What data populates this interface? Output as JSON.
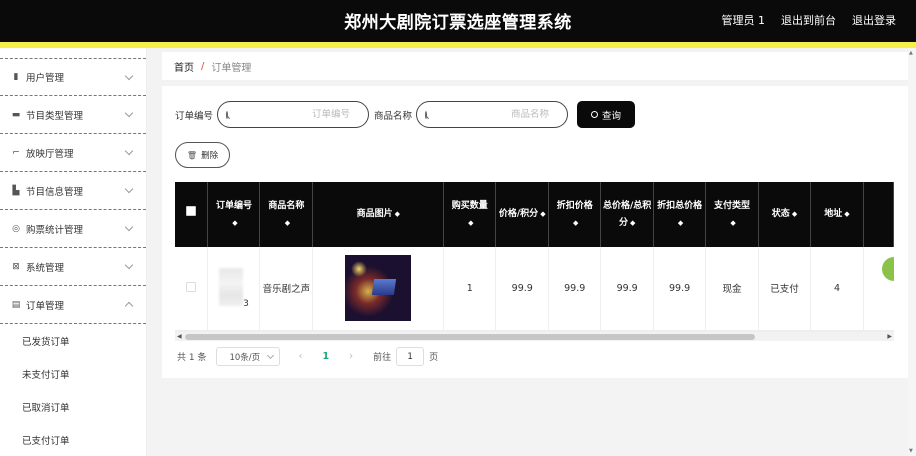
{
  "header": {
    "title": "郑州大剧院订票选座管理系统",
    "admin": "管理员 1",
    "to_front": "退出到前台",
    "logout": "退出登录"
  },
  "colors": {
    "accent_bar": "#f6ef4a",
    "header_bg": "#0a0a0a",
    "active_page": "#19a974",
    "status_dot": "#8bc34a"
  },
  "sidebar": {
    "items": [
      {
        "label": "用户管理",
        "icon": "bar-chart-icon"
      },
      {
        "label": "节目类型管理",
        "icon": "chat-icon"
      },
      {
        "label": "放映厅管理",
        "icon": "crop-icon"
      },
      {
        "label": "节目信息管理",
        "icon": "thumb-up-icon"
      },
      {
        "label": "购票统计管理",
        "icon": "disc-icon"
      },
      {
        "label": "系统管理",
        "icon": "grid-icon"
      },
      {
        "label": "订单管理",
        "icon": "document-icon"
      }
    ],
    "sub_items": [
      "已发货订单",
      "未支付订单",
      "已取消订单",
      "已支付订单"
    ]
  },
  "breadcrumb": {
    "home": "首页",
    "sep": "/",
    "current": "订单管理"
  },
  "search": {
    "order_label": "订单编号",
    "order_placeholder": "订单编号",
    "goods_label": "商品名称",
    "goods_placeholder": "商品名称",
    "query_label": "查询"
  },
  "actions": {
    "delete_label": "删除"
  },
  "table": {
    "headers": [
      "订单编号",
      "商品名称",
      "商品图片",
      "购买数量",
      "价格/积分",
      "折扣价格",
      "总价格/总积分",
      "折扣总价格",
      "支付类型",
      "状态",
      "地址"
    ],
    "row": {
      "order_no_tail": "3",
      "goods_name": "音乐剧之声",
      "image": "concert-stage-photo",
      "quantity": "1",
      "price": "99.9",
      "discount_price": "99.9",
      "total": "99.9",
      "discount_total": "99.9",
      "pay_type": "现金",
      "status": "已支付",
      "address": "4"
    }
  },
  "pagination": {
    "total": "共 1 条",
    "page_size": "10条/页",
    "current_page": "1",
    "goto_label": "前往",
    "goto_value": "1",
    "page_suffix": "页"
  }
}
